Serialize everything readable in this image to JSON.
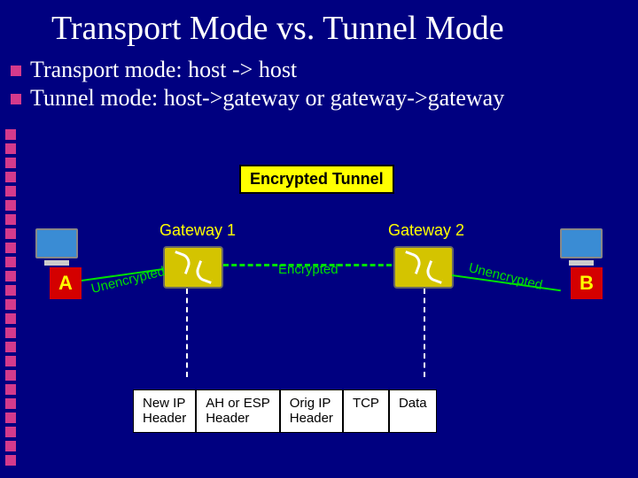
{
  "title": "Transport Mode vs. Tunnel Mode",
  "bullets": {
    "b1": "Transport mode: host -> host",
    "b2": "Tunnel mode: host->gateway or gateway->gateway"
  },
  "labels": {
    "tunnel_box": "Encrypted Tunnel",
    "gw1": "Gateway 1",
    "gw2": "Gateway 2",
    "hostA": "A",
    "hostB": "B",
    "unencrypted_left": "Unencrypted",
    "encrypted_center": "Encrypted",
    "unencrypted_right": "Unencrypted"
  },
  "packet": {
    "c1a": "New IP",
    "c1b": "Header",
    "c2a": "AH or ESP",
    "c2b": "Header",
    "c3a": "Orig IP",
    "c3b": "Header",
    "c4": "TCP",
    "c5": "Data"
  }
}
